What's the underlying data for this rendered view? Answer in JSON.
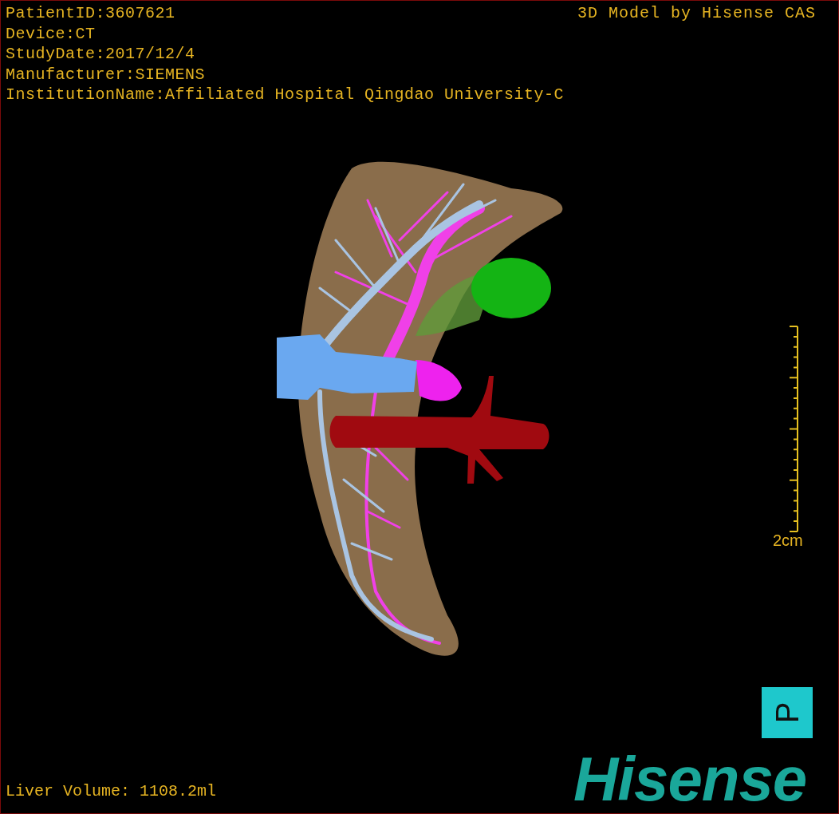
{
  "header": {
    "info_lines": [
      "PatientID:3607621",
      "Device:CT",
      "StudyDate:2017/12/4",
      "Manufacturer:SIEMENS",
      "InstitutionName:Affiliated Hospital Qingdao University-C"
    ],
    "model_credit": "3D Model by Hisense CAS"
  },
  "scale_bar": {
    "label": "2cm"
  },
  "orientation_marker": {
    "label": "P"
  },
  "liver_volume": "Liver Volume: 1108.2ml",
  "logo": "Hisense"
}
